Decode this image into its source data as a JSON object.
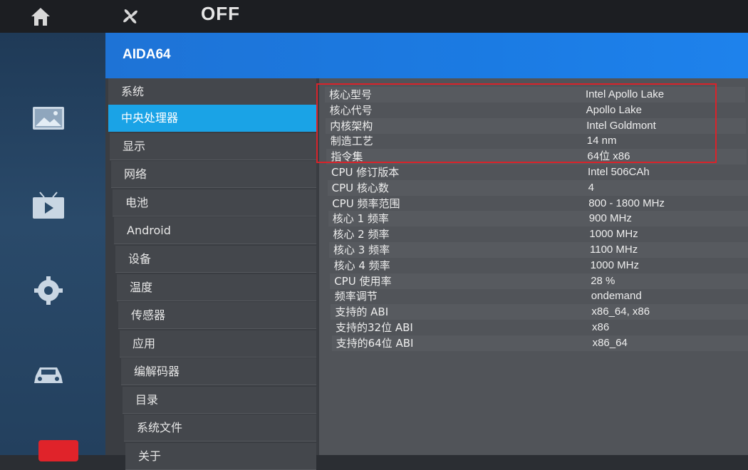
{
  "topbar": {
    "icons": [
      "home-icon",
      "fan-icon"
    ],
    "status_label": "OFF"
  },
  "left_rail": {
    "icons": [
      "gallery-icon",
      "video-icon",
      "settings-icon",
      "car-icon",
      "app-64-icon"
    ]
  },
  "app": {
    "title": "AIDA64"
  },
  "nav": {
    "items": [
      {
        "label": "系统",
        "active": false
      },
      {
        "label": "中央处理器",
        "active": true
      },
      {
        "label": "显示",
        "active": false
      },
      {
        "label": "网络",
        "active": false
      },
      {
        "label": "电池",
        "active": false
      },
      {
        "label": "Android",
        "active": false
      },
      {
        "label": "设备",
        "active": false
      },
      {
        "label": "温度",
        "active": false
      },
      {
        "label": "传感器",
        "active": false
      },
      {
        "label": "应用",
        "active": false
      },
      {
        "label": "编解码器",
        "active": false
      },
      {
        "label": "目录",
        "active": false
      },
      {
        "label": "系统文件",
        "active": false
      },
      {
        "label": "关于",
        "active": false
      }
    ]
  },
  "cpu_info": [
    {
      "key": "核心型号",
      "value": "Intel Apollo Lake"
    },
    {
      "key": "核心代号",
      "value": "Apollo Lake"
    },
    {
      "key": "内核架构",
      "value": "Intel Goldmont"
    },
    {
      "key": "制造工艺",
      "value": "14 nm"
    },
    {
      "key": "指令集",
      "value": "64位 x86"
    },
    {
      "key": "CPU 修订版本",
      "value": "Intel 506CAh"
    },
    {
      "key": "CPU 核心数",
      "value": "4"
    },
    {
      "key": "CPU 频率范围",
      "value": "800 - 1800 MHz"
    },
    {
      "key": "核心 1 频率",
      "value": "900 MHz"
    },
    {
      "key": "核心 2 频率",
      "value": "1000 MHz"
    },
    {
      "key": "核心 3 频率",
      "value": "1100 MHz"
    },
    {
      "key": "核心 4 频率",
      "value": "1000 MHz"
    },
    {
      "key": "CPU 使用率",
      "value": "28 %"
    },
    {
      "key": "频率调节",
      "value": "ondemand"
    },
    {
      "key": "支持的 ABI",
      "value": "x86_64, x86"
    },
    {
      "key": "支持的32位 ABI",
      "value": "x86"
    },
    {
      "key": "支持的64位 ABI",
      "value": "x86_64"
    }
  ],
  "colors": {
    "accent_blue": "#1e78e0",
    "active_item": "#1aa3e6",
    "highlight_border": "#d9232a"
  }
}
